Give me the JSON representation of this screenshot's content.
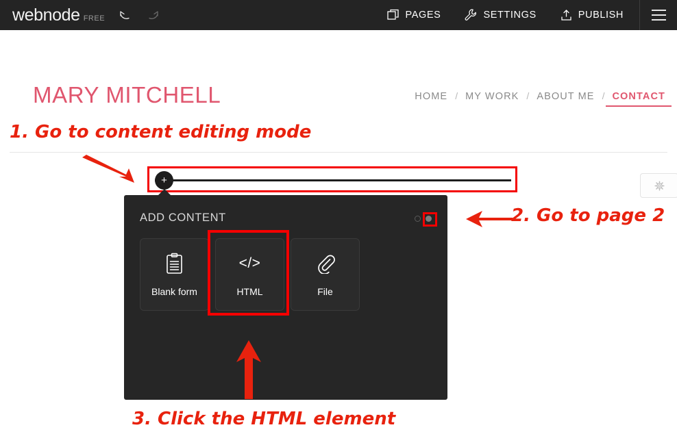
{
  "editor": {
    "brand": "webnode",
    "plan": "FREE",
    "history": [
      {
        "name": "undo",
        "icon": "undo-arrow-icon",
        "enabled": true
      },
      {
        "name": "redo",
        "icon": "redo-arrow-icon",
        "enabled": false
      }
    ],
    "nav": [
      {
        "label": "PAGES",
        "icon": "pages-icon"
      },
      {
        "label": "SETTINGS",
        "icon": "wrench-icon"
      },
      {
        "label": "PUBLISH",
        "icon": "upload-icon"
      }
    ],
    "menu_icon": "hamburger-menu-icon"
  },
  "site": {
    "logo": "MARY MITCHELL",
    "separator": "/",
    "nav": [
      {
        "label": "HOME",
        "active": false
      },
      {
        "label": "MY WORK",
        "active": false
      },
      {
        "label": "ABOUT ME",
        "active": false
      },
      {
        "label": "CONTACT",
        "active": true
      }
    ],
    "accent_color": "#e0566e"
  },
  "add_bar": {
    "plus_label": "+",
    "plus_icon": "plus-icon"
  },
  "settings_button": {
    "icon": "gear-icon"
  },
  "panel": {
    "title": "ADD CONTENT",
    "pagination": {
      "current_page": 2,
      "total_pages": 2
    },
    "tiles": [
      {
        "label": "Blank form",
        "icon": "clipboard-form-icon"
      },
      {
        "label": "HTML",
        "icon": "code-brackets-icon",
        "glyph": "</>",
        "highlighted": true
      },
      {
        "label": "File",
        "icon": "paperclip-icon"
      }
    ]
  },
  "annotations": [
    {
      "id": 1,
      "text": "1. Go to content editing mode",
      "arrow": "diagonal-down-right-arrow"
    },
    {
      "id": 2,
      "text": "2. Go to page 2",
      "arrow": "left-arrow"
    },
    {
      "id": 3,
      "text": "3. Click the HTML element",
      "arrow": "up-arrow"
    }
  ],
  "highlight_color": "#f40000"
}
